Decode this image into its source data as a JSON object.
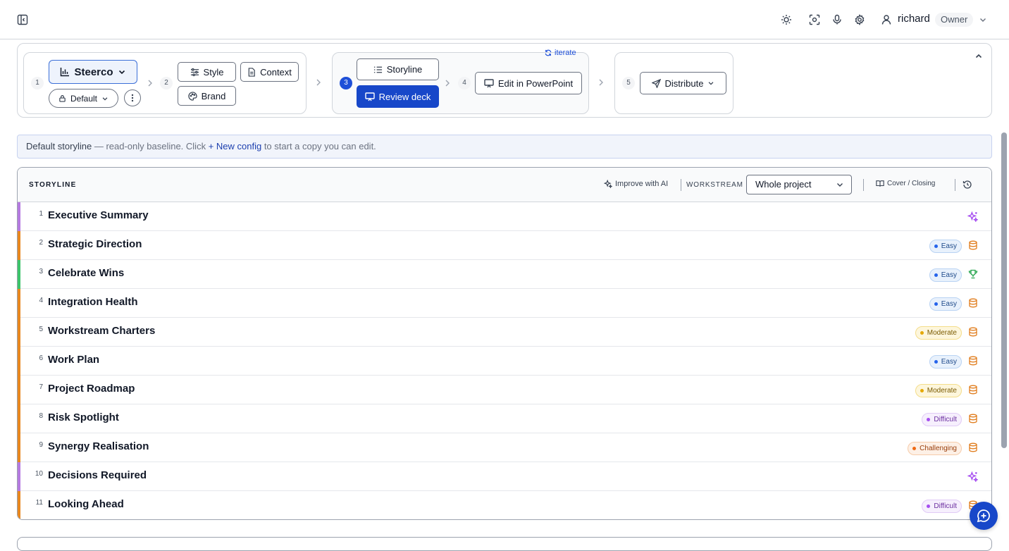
{
  "topbar": {
    "user_name": "richard",
    "role_badge": "Owner"
  },
  "pipeline": {
    "step1": {
      "num": "1",
      "report_button": "Steerco",
      "config_pill": "Default"
    },
    "step2": {
      "num": "2",
      "style": "Style",
      "context": "Context",
      "brand": "Brand"
    },
    "step3": {
      "num": "3",
      "storyline": "Storyline",
      "review": "Review deck",
      "iterate": "iterate"
    },
    "step4": {
      "num": "4",
      "edit": "Edit in PowerPoint"
    },
    "step5": {
      "num": "5",
      "distribute": "Distribute"
    }
  },
  "notice": {
    "title": "Default storyline",
    "text_before": " — read-only baseline. Click ",
    "link": "+ New config",
    "text_after": " to start a copy you can edit."
  },
  "storyline": {
    "header": "STORYLINE",
    "improve": "Improve with AI",
    "workstream_label": "WORKSTREAM",
    "workstream_value": "Whole project",
    "cover_closing": "Cover / Closing"
  },
  "rows": [
    {
      "num": "1",
      "title": "Executive Summary",
      "difficulty": "",
      "icon": "sparkles-icon",
      "bar_color": "#b57ae0"
    },
    {
      "num": "2",
      "title": "Strategic Direction",
      "difficulty": "Easy",
      "icon": "database-icon",
      "bar_color": "#e8871e"
    },
    {
      "num": "3",
      "title": "Celebrate Wins",
      "difficulty": "Easy",
      "icon": "trophy-icon",
      "bar_color": "#3cc46a"
    },
    {
      "num": "4",
      "title": "Integration Health",
      "difficulty": "Easy",
      "icon": "database-icon",
      "bar_color": "#e8871e"
    },
    {
      "num": "5",
      "title": "Workstream Charters",
      "difficulty": "Moderate",
      "icon": "database-icon",
      "bar_color": "#e8871e"
    },
    {
      "num": "6",
      "title": "Work Plan",
      "difficulty": "Easy",
      "icon": "database-icon",
      "bar_color": "#e8871e"
    },
    {
      "num": "7",
      "title": "Project Roadmap",
      "difficulty": "Moderate",
      "icon": "database-icon",
      "bar_color": "#e8871e"
    },
    {
      "num": "8",
      "title": "Risk Spotlight",
      "difficulty": "Difficult",
      "icon": "database-icon",
      "bar_color": "#e8871e"
    },
    {
      "num": "9",
      "title": "Synergy Realisation",
      "difficulty": "Challenging",
      "icon": "database-icon",
      "bar_color": "#e8871e"
    },
    {
      "num": "10",
      "title": "Decisions Required",
      "difficulty": "",
      "icon": "sparkles-icon",
      "bar_color": "#b57ae0"
    },
    {
      "num": "11",
      "title": "Looking Ahead",
      "difficulty": "Difficult",
      "icon": "database-icon",
      "bar_color": "#e8871e"
    }
  ],
  "colors": {
    "primary": "#1747c9",
    "easy": "#2563eb",
    "moderate": "#e5a800",
    "difficult": "#a64ef0",
    "challenging": "#ef6a14",
    "data_icon": "#e07b1a",
    "trophy_icon": "#22a34a",
    "sparkle_icon": "#a64ef0"
  }
}
